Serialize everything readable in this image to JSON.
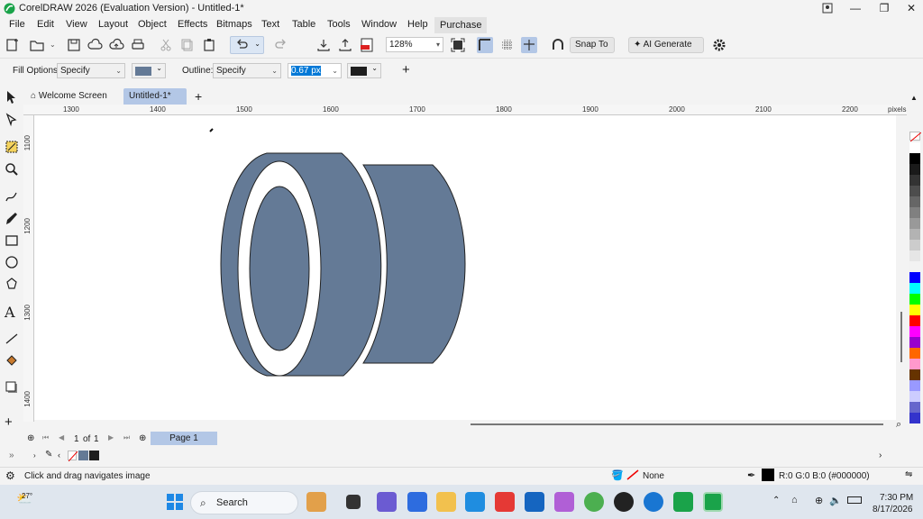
{
  "window": {
    "title": "CorelDRAW 2026 (Evaluation Version) - Untitled-1*",
    "minimize": "—",
    "restore": "❐",
    "close": "✕"
  },
  "menu": [
    "File",
    "Edit",
    "View",
    "Layout",
    "Object",
    "Effects",
    "Bitmaps",
    "Text",
    "Table",
    "Tools",
    "Window",
    "Help",
    "Purchase"
  ],
  "toolbar": {
    "zoom": "128%",
    "snap_to": "Snap To",
    "ai_generate": "AI Generate"
  },
  "properties": {
    "fill_label": "Fill Options:",
    "fill_value": "Specify",
    "outline_label": "Outline:",
    "outline_value": "Specify",
    "outline_width": "0.67 px",
    "fill_color": "#647a96",
    "outline_color": "#1e1e1e"
  },
  "tabs": {
    "welcome": "Welcome Screen",
    "document": "Untitled-1*"
  },
  "ruler": {
    "h_ticks": [
      "1300",
      "1400",
      "1500",
      "1600",
      "1700",
      "1800",
      "1900",
      "2000",
      "2100",
      "2200"
    ],
    "v_ticks": [
      "1100",
      "1200",
      "1300",
      "1400"
    ],
    "unit": "pixels"
  },
  "page_nav": {
    "current": "1",
    "of": "of",
    "total": "1",
    "page_tab": "Page 1"
  },
  "status": {
    "hint": "Click and drag navigates image",
    "fill": "None",
    "outline": "R:0 G:0 B:0 (#000000)"
  },
  "taskbar": {
    "weather": "27°",
    "search": "Search",
    "time": "7:30 PM",
    "date": "8/17/2026"
  },
  "palette_colors": [
    "#ffffff",
    "#000000",
    "#1a1a1a",
    "#333333",
    "#4d4d4d",
    "#666666",
    "#808080",
    "#999999",
    "#b3b3b3",
    "#cccccc",
    "#e6e6e6",
    "#f2f2f2",
    "#0000ff",
    "#00ffff",
    "#00ff00",
    "#ffff00",
    "#ff0000",
    "#ff00ff",
    "#9900cc",
    "#ff6600",
    "#ff99cc",
    "#663300",
    "#9999ff",
    "#ccccff",
    "#6666cc",
    "#3333cc"
  ],
  "colors": {
    "shape_fill": "#647a96",
    "accent": "#b3c7e6"
  }
}
